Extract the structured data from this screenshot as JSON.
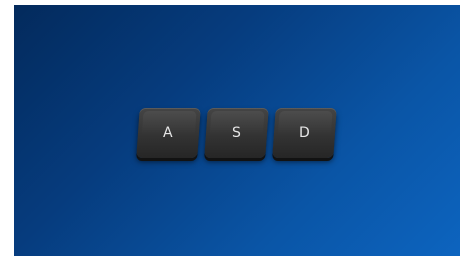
{
  "keys": [
    {
      "label": "A"
    },
    {
      "label": "S"
    },
    {
      "label": "D"
    }
  ],
  "colors": {
    "background_dark": "#032a5c",
    "background_light": "#0d64bf",
    "key_face": "#333333",
    "key_text": "#e6e6e6"
  }
}
